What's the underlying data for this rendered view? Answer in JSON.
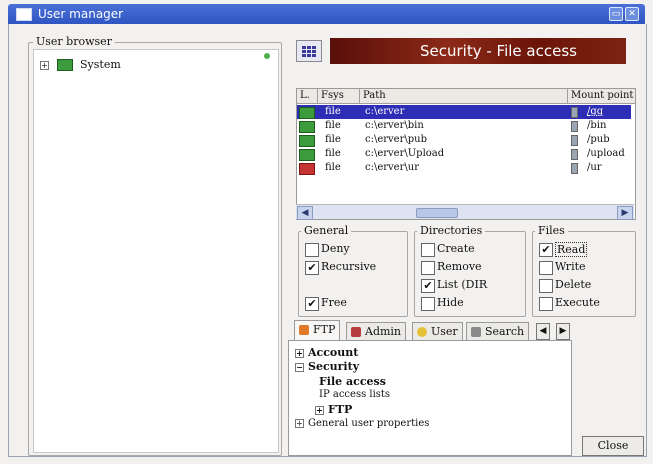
{
  "window": {
    "title": "User manager"
  },
  "left_panel": {
    "legend": "User browser",
    "tree": [
      {
        "label": "System",
        "expander": "+"
      }
    ]
  },
  "banner": {
    "title": "Security - File access"
  },
  "table": {
    "columns": [
      "L.",
      "Fsys",
      "Path",
      "Mount point"
    ],
    "rows": [
      {
        "fsys": "file",
        "path": "c:\\erver",
        "mount": "/gg",
        "status": "ok",
        "selected": true
      },
      {
        "fsys": "file",
        "path": "c:\\erver\\bin",
        "mount": "/bin",
        "status": "ok",
        "selected": false
      },
      {
        "fsys": "file",
        "path": "c:\\erver\\pub",
        "mount": "/pub",
        "status": "ok",
        "selected": false
      },
      {
        "fsys": "file",
        "path": "c:\\erver\\Upload",
        "mount": "/upload",
        "status": "ok",
        "selected": false
      },
      {
        "fsys": "file",
        "path": "c:\\erver\\ur",
        "mount": "/ur",
        "status": "warn",
        "selected": false
      }
    ]
  },
  "groups": {
    "general": {
      "legend": "General",
      "deny": "Deny",
      "recursive": "Recursive",
      "free": "Free"
    },
    "directories": {
      "legend": "Directories",
      "create": "Create",
      "remove": "Remove",
      "list": "List (DIR",
      "hide": "Hide"
    },
    "files": {
      "legend": "Files",
      "read": "Read",
      "write": "Write",
      "delete": "Delete",
      "execute": "Execute"
    }
  },
  "checks": {
    "deny": false,
    "recursive": true,
    "free": true,
    "create": false,
    "remove": false,
    "list": true,
    "hide": false,
    "read": true,
    "write": false,
    "delete": false,
    "execute": false
  },
  "tabs": {
    "ftp": "FTP",
    "admin": "Admin",
    "user": "User",
    "search": "Search"
  },
  "nav_tree": {
    "account": "Account",
    "security": "Security",
    "file_access": "File access",
    "ip_access": "IP access lists",
    "ftp": "FTP",
    "general_props": "General user properties"
  },
  "buttons": {
    "close": "Close"
  },
  "colors": {
    "title_bar": "#2f55c2",
    "selection": "#2d2eb5",
    "banner": "#7d2312"
  }
}
